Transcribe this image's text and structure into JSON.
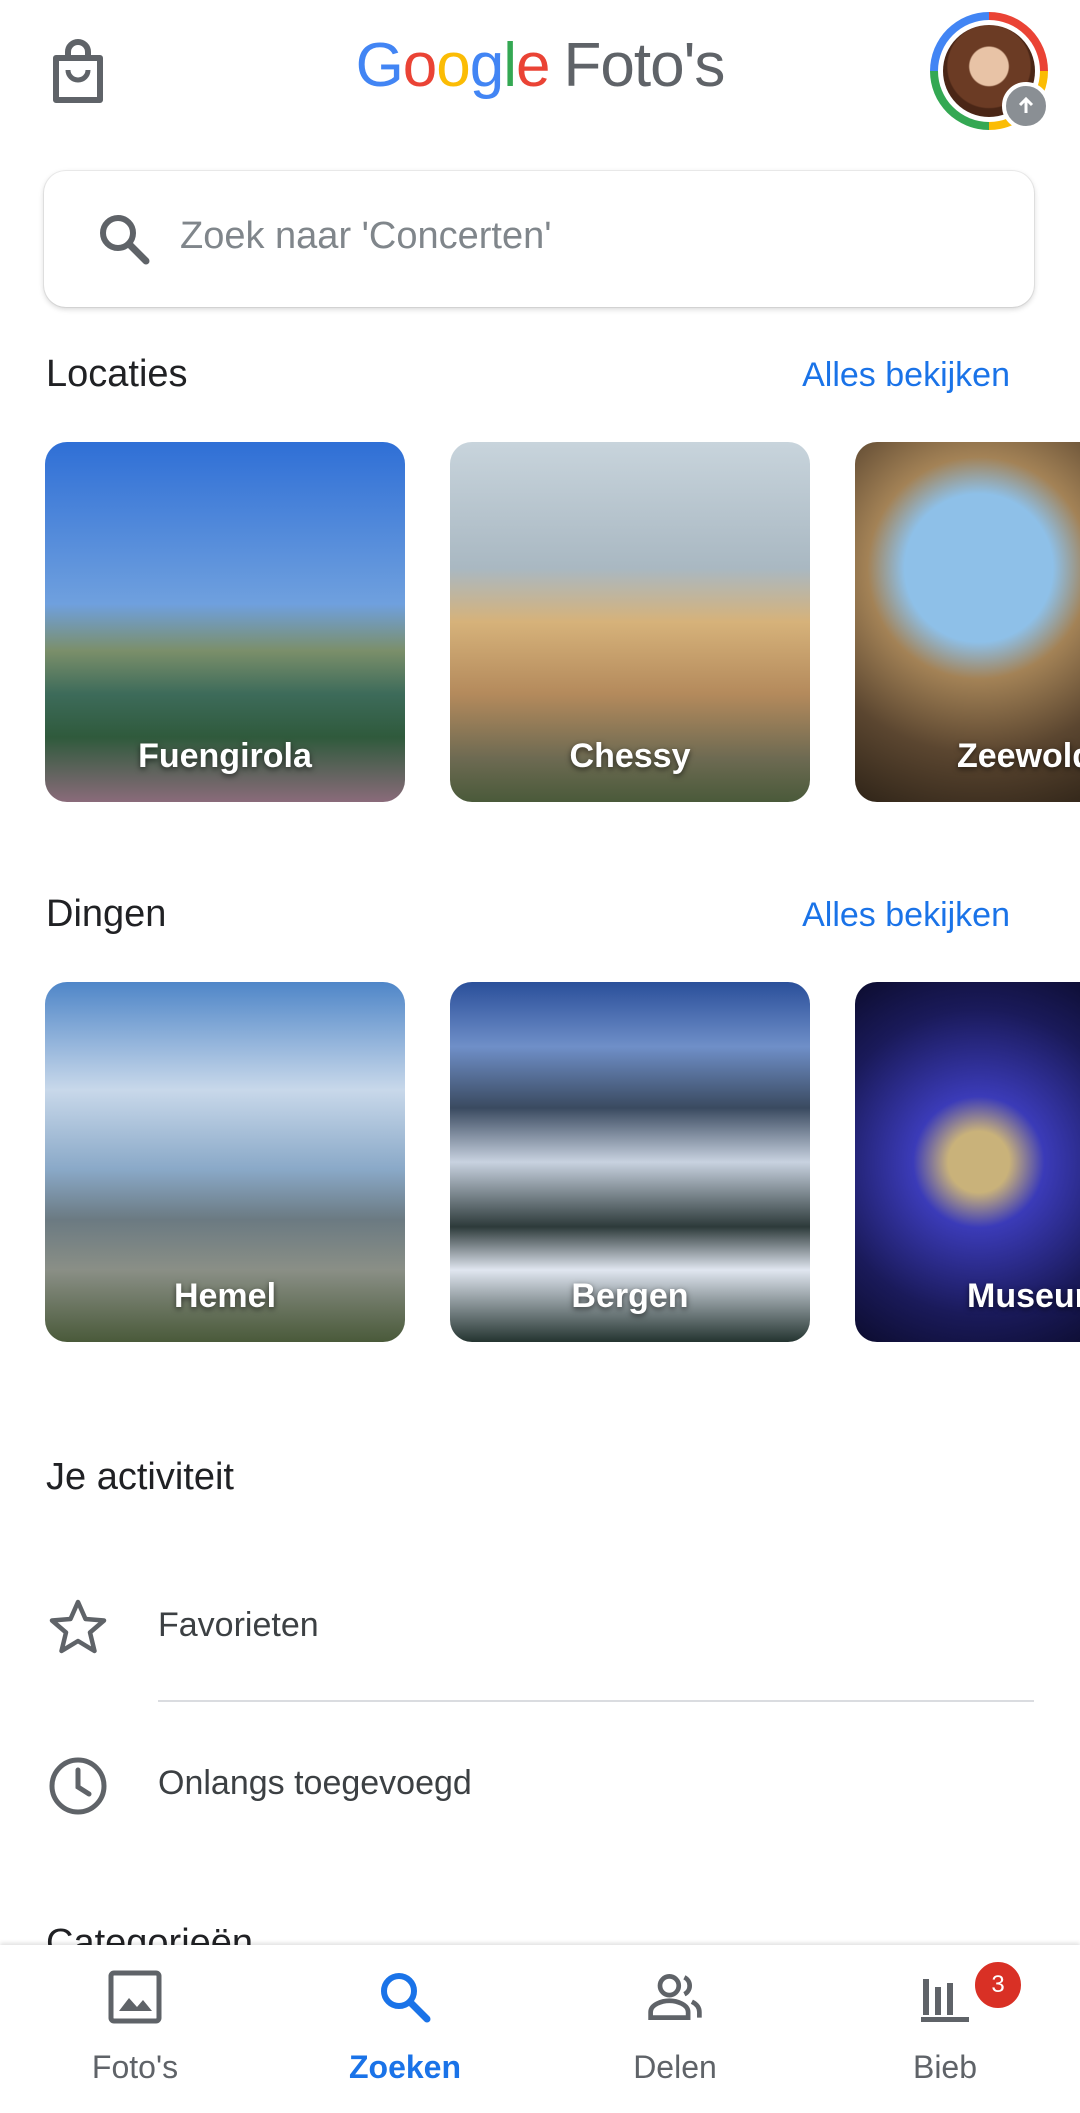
{
  "header": {
    "logo_parts": [
      "G",
      "o",
      "o",
      "g",
      "l",
      "e"
    ],
    "product": "Foto's"
  },
  "search": {
    "placeholder": "Zoek naar 'Concerten'"
  },
  "locations": {
    "title": "Locaties",
    "see_all": "Alles bekijken",
    "items": [
      {
        "label": "Fuengirola"
      },
      {
        "label": "Chessy"
      },
      {
        "label": "Zeewold"
      }
    ]
  },
  "things": {
    "title": "Dingen",
    "see_all": "Alles bekijken",
    "items": [
      {
        "label": "Hemel"
      },
      {
        "label": "Bergen"
      },
      {
        "label": "Museur"
      }
    ]
  },
  "activity": {
    "title": "Je activiteit",
    "items": [
      {
        "label": "Favorieten",
        "icon": "star-icon"
      },
      {
        "label": "Onlangs toegevoegd",
        "icon": "clock-icon"
      }
    ]
  },
  "next_section": {
    "title": "Categorieën"
  },
  "bottom_nav": {
    "items": [
      {
        "label": "Foto's",
        "icon": "photo-icon"
      },
      {
        "label": "Zoeken",
        "icon": "search-icon",
        "active": true
      },
      {
        "label": "Delen",
        "icon": "people-icon"
      },
      {
        "label": "Bieb",
        "icon": "library-icon",
        "badge": "3"
      }
    ]
  },
  "colors": {
    "accent": "#1a73e8",
    "badge": "#d93025"
  }
}
